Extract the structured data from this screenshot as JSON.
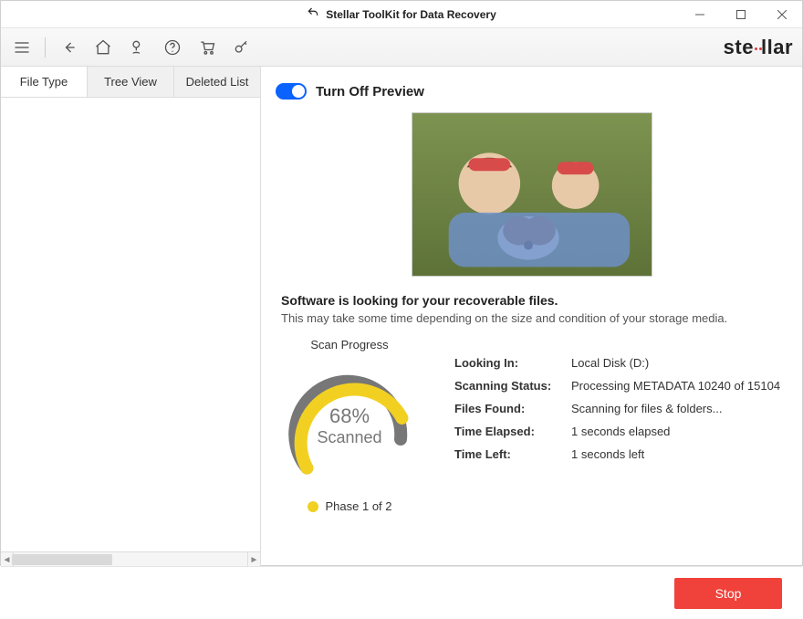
{
  "window": {
    "title": "Stellar ToolKit for Data Recovery"
  },
  "brand": {
    "pre": "ste",
    "post": "ar",
    "mid": "ll"
  },
  "sidebar": {
    "tabs": [
      {
        "label": "File Type"
      },
      {
        "label": "Tree View"
      },
      {
        "label": "Deleted List"
      }
    ]
  },
  "preview_toggle": {
    "label": "Turn Off Preview",
    "on": true
  },
  "status": {
    "heading": "Software is looking for your recoverable files.",
    "subheading": "This may take some time depending on the size and condition of your storage media."
  },
  "progress": {
    "caption": "Scan Progress",
    "percent_text": "68%",
    "scanned_word": "Scanned",
    "phase": "Phase 1 of 2",
    "colors": {
      "done": "#f2d022",
      "remain": "#777"
    }
  },
  "info": {
    "looking_in": {
      "k": "Looking In:",
      "v": "Local Disk (D:)"
    },
    "status": {
      "k": "Scanning Status:",
      "v": "Processing METADATA 10240 of 15104"
    },
    "files_found": {
      "k": "Files Found:",
      "v": "Scanning for files & folders..."
    },
    "time_elapsed": {
      "k": "Time Elapsed:",
      "v": "1 seconds elapsed"
    },
    "time_left": {
      "k": "Time Left:",
      "v": "1 seconds left"
    }
  },
  "footer": {
    "stop": "Stop"
  }
}
